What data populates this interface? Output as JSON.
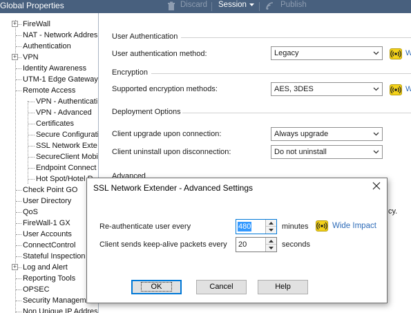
{
  "titlebar": {
    "title": "Global Properties",
    "discard": "Discard",
    "session": "Session",
    "publish": "Publish"
  },
  "tree": [
    {
      "label": "FireWall",
      "expandable": true
    },
    {
      "label": "NAT - Network Addres",
      "expandable": false
    },
    {
      "label": "Authentication",
      "expandable": false
    },
    {
      "label": "VPN",
      "expandable": true
    },
    {
      "label": "Identity Awareness",
      "expandable": false
    },
    {
      "label": "UTM-1 Edge Gateway",
      "expandable": false
    },
    {
      "label": "Remote Access",
      "expandable": false,
      "expanded": true
    },
    {
      "label": "VPN - Authenticati",
      "child": true
    },
    {
      "label": "VPN - Advanced",
      "child": true
    },
    {
      "label": "Certificates",
      "child": true
    },
    {
      "label": "Secure Configurati",
      "child": true
    },
    {
      "label": "SSL Network Exte",
      "child": true
    },
    {
      "label": "SecureClient Mobil",
      "child": true
    },
    {
      "label": "Endpoint Connect",
      "child": true
    },
    {
      "label": "Hot Spot/Hotel R",
      "child": true
    },
    {
      "label": "Check Point GO",
      "expandable": false
    },
    {
      "label": "User Directory",
      "expandable": false
    },
    {
      "label": "QoS",
      "expandable": false
    },
    {
      "label": "FireWall-1 GX",
      "expandable": false
    },
    {
      "label": "User Accounts",
      "expandable": false
    },
    {
      "label": "ConnectControl",
      "expandable": false
    },
    {
      "label": "Stateful Inspection",
      "expandable": false
    },
    {
      "label": "Log and Alert",
      "expandable": true
    },
    {
      "label": "Reporting Tools",
      "expandable": false
    },
    {
      "label": "OPSEC",
      "expandable": false
    },
    {
      "label": "Security Manageme",
      "expandable": false
    },
    {
      "label": "Non Unique IP Addres",
      "expandable": false
    }
  ],
  "content": {
    "user_auth": {
      "section": "User Authentication",
      "method_label": "User authentication method:",
      "method_value": "Legacy",
      "link": "W"
    },
    "encryption": {
      "section": "Encryption",
      "methods_label": "Supported encryption methods:",
      "methods_value": "AES, 3DES",
      "link": "W"
    },
    "deployment": {
      "section": "Deployment Options",
      "upgrade_label": "Client upgrade upon connection:",
      "upgrade_value": "Always upgrade",
      "uninstall_label": "Client uninstall upon disconnection:",
      "uninstall_value": "Do not uninstall"
    },
    "advanced": {
      "section": "Advanced",
      "fragment": "cy."
    }
  },
  "dialog": {
    "title": "SSL Network Extender - Advanced Settings",
    "reauth_label": "Re-authenticate user every",
    "reauth_value": "480",
    "reauth_unit": "minutes",
    "impact_link": "Wide Impact",
    "keepalive_label": "Client sends keep-alive packets every",
    "keepalive_value": "20",
    "keepalive_unit": "seconds",
    "ok": "OK",
    "cancel": "Cancel",
    "help": "Help"
  },
  "colors": {
    "titlebar": "#48607e",
    "link": "#2d6bb8",
    "impact_icon": "#f4d21a",
    "focus": "#0078d7"
  }
}
